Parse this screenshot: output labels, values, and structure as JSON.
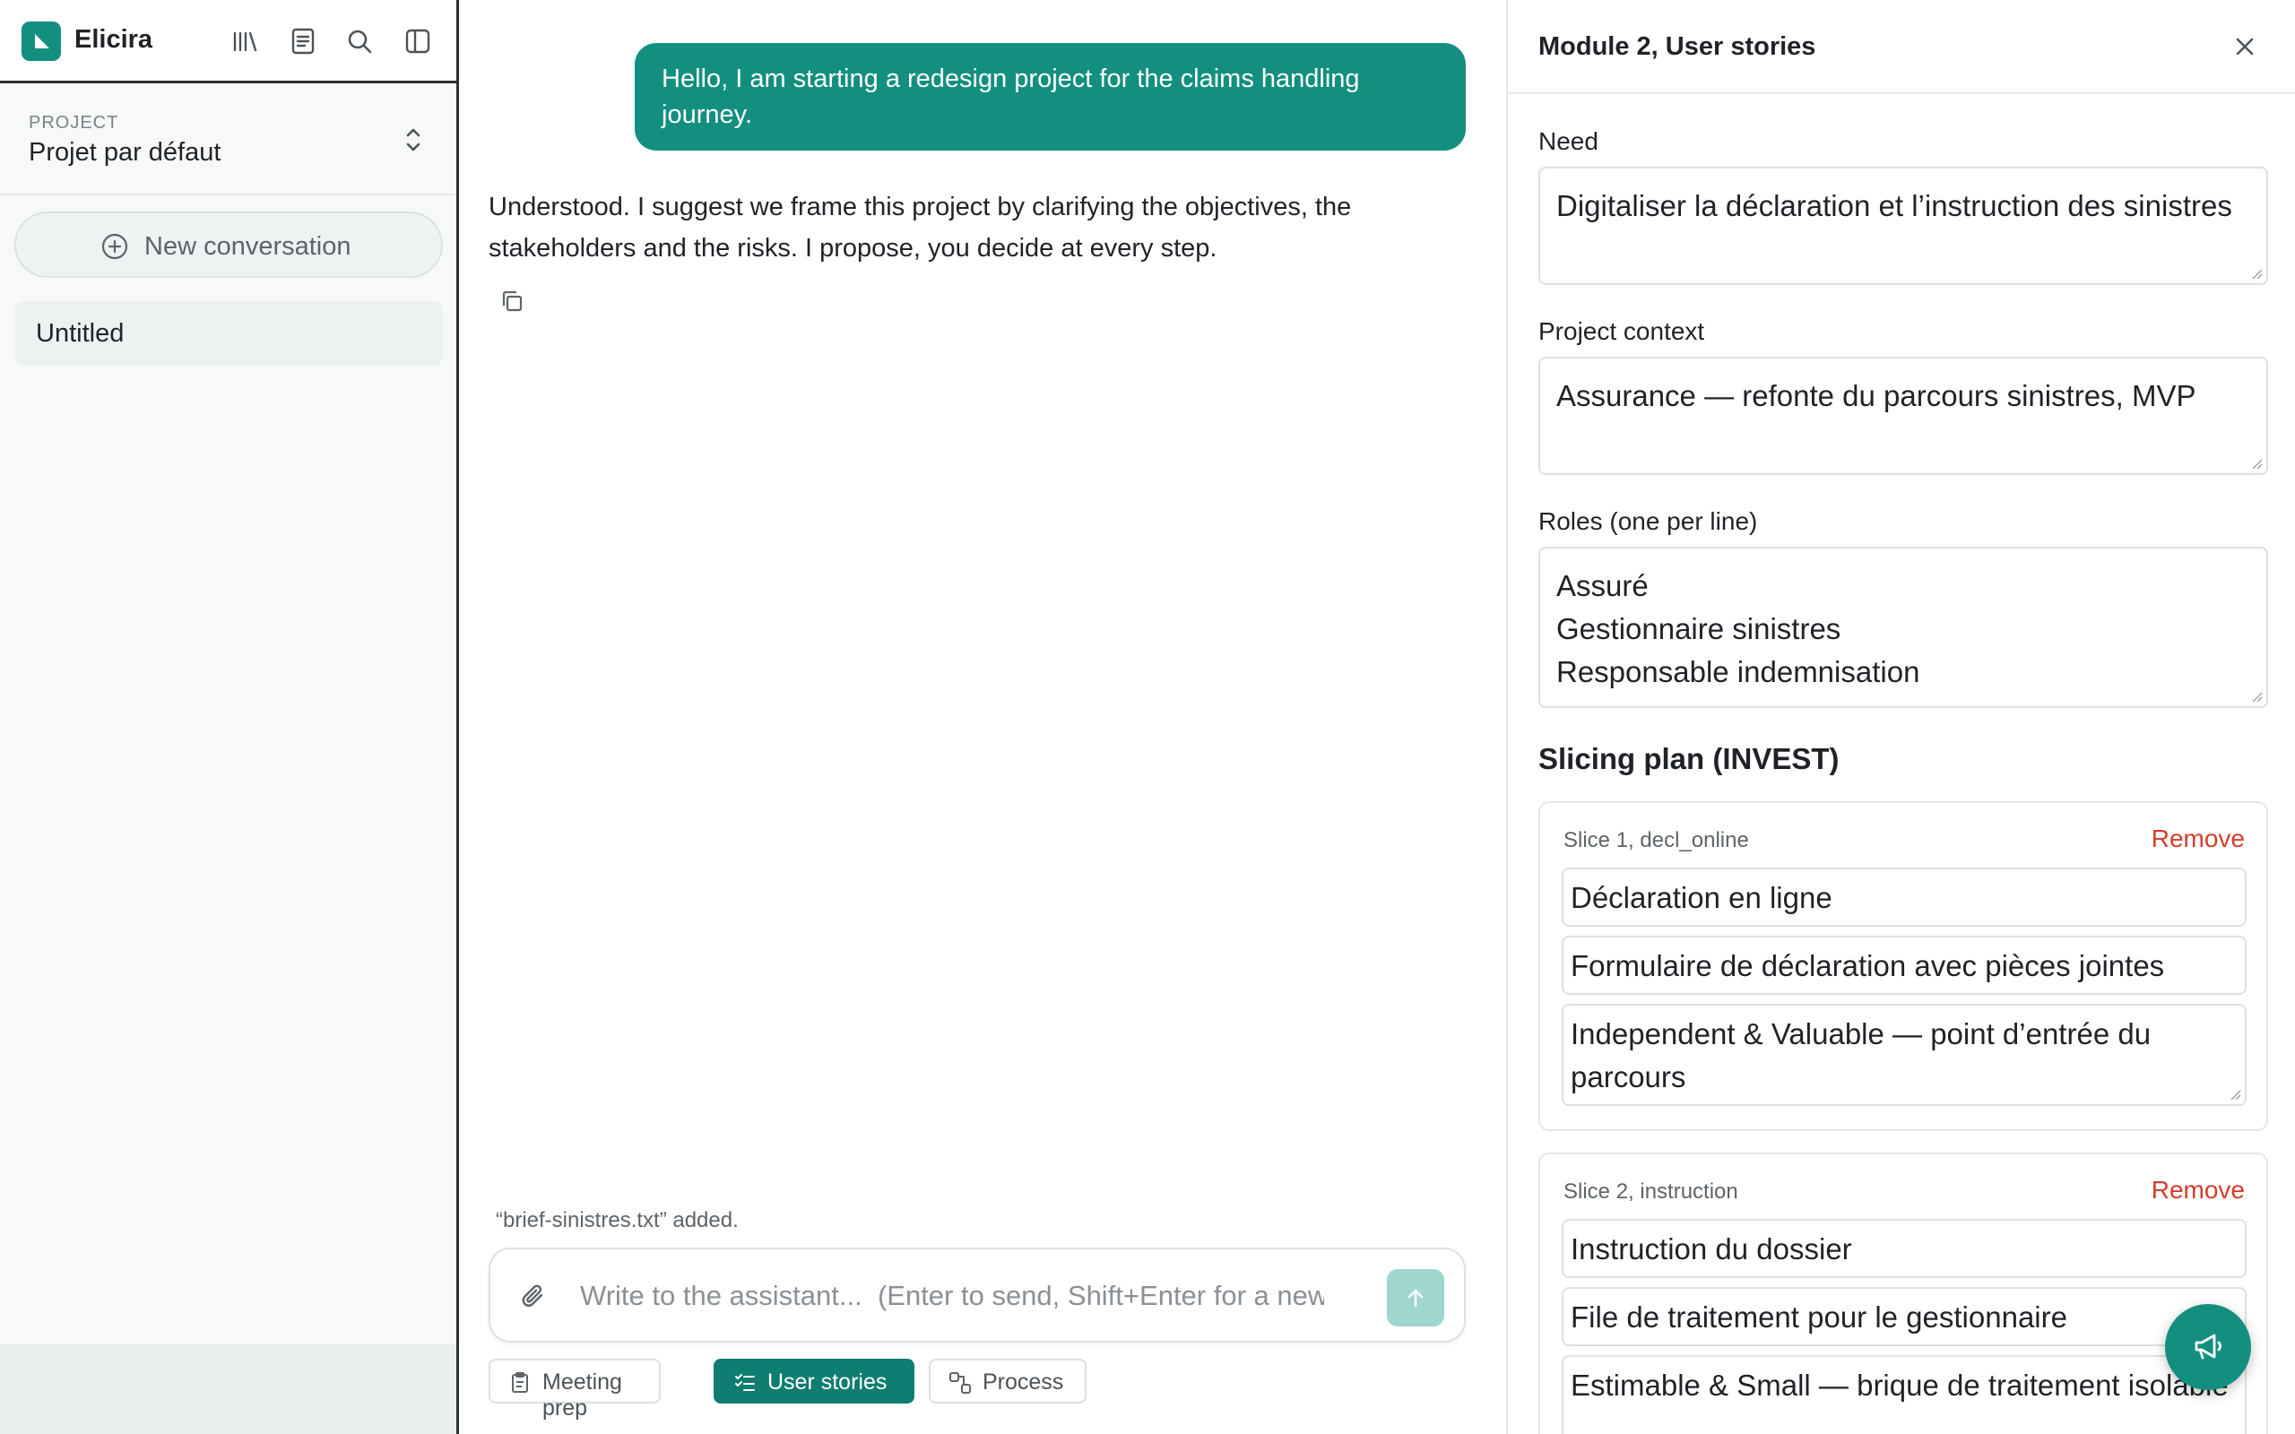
{
  "app": {
    "name": "Elicira"
  },
  "sidebar": {
    "project_label": "PROJECT",
    "project_name": "Projet par défaut",
    "new_conversation": "New conversation",
    "conversations": [
      {
        "label": "Untitled"
      }
    ]
  },
  "chat": {
    "user_message": "Hello, I am starting a redesign project for the claims handling journey.",
    "assistant_message": "Understood. I suggest we frame this project by clarifying the objectives, the stakeholders and the risks. I propose, you decide at every step.",
    "file_note": "“brief-sinistres.txt” added.",
    "composer_placeholder": "Write to the assistant...  (Enter to send, Shift+Enter for a new line)",
    "modes": [
      {
        "label": "Meeting prep",
        "icon": "clipboard-icon"
      },
      {
        "label": "User stories",
        "icon": "checklist-icon",
        "active": true
      },
      {
        "label": "Process",
        "icon": "process-icon"
      }
    ]
  },
  "panel": {
    "title": "Module 2, User stories",
    "need_label": "Need",
    "need_value": "Digitaliser la déclaration et l’instruction des sinistres",
    "context_label": "Project context",
    "context_value": "Assurance — refonte du parcours sinistres, MVP",
    "roles_label": "Roles (one per line)",
    "roles": [
      "Assuré",
      "Gestionnaire sinistres",
      "Responsable indemnisation"
    ],
    "slicing_title": "Slicing plan (INVEST)",
    "remove_label": "Remove",
    "slices": [
      {
        "label": "Slice 1, decl_online",
        "title": "Déclaration en ligne",
        "description": "Formulaire de déclaration avec pièces jointes",
        "invest": "Independent & Valuable — point d’entrée du parcours"
      },
      {
        "label": "Slice 2, instruction",
        "title": "Instruction du dossier",
        "description": "File de traitement pour le gestionnaire",
        "invest": "Estimable & Small — brique de traitement isolable"
      }
    ]
  },
  "colors": {
    "accent": "#138f80",
    "accent_dark": "#0f7d70",
    "danger": "#d43d2c",
    "send_disabled": "#9fd6cf"
  }
}
